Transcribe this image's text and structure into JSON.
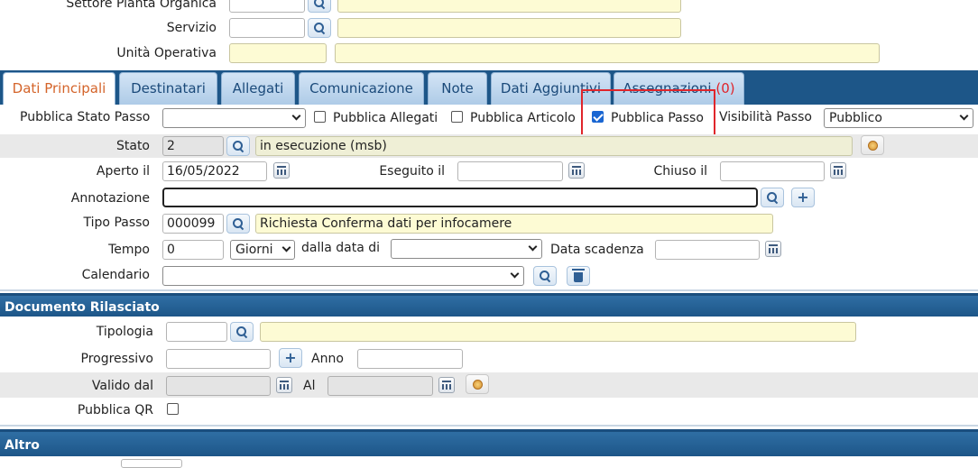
{
  "top_fields": {
    "settore_label": "Settore Pianta Organica",
    "servizio_label": "Servizio",
    "unita_label": "Unità Operativa"
  },
  "tabs": [
    {
      "label": "Dati Principali",
      "active": true
    },
    {
      "label": "Destinatari"
    },
    {
      "label": "Allegati"
    },
    {
      "label": "Comunicazione"
    },
    {
      "label": "Note"
    },
    {
      "label": "Dati Aggiuntivi"
    },
    {
      "label": "Assegnazioni",
      "count": "(0)"
    }
  ],
  "publish_row": {
    "stato_passo_label": "Pubblica Stato Passo",
    "stato_passo_value": "",
    "allegati_label": "Pubblica Allegati",
    "allegati_checked": false,
    "articolo_label": "Pubblica Articolo",
    "articolo_checked": false,
    "passo_label": "Pubblica Passo",
    "passo_checked": true,
    "visibilita_label": "Visibilità Passo",
    "visibilita_value": "Pubblico"
  },
  "stato": {
    "label": "Stato",
    "code": "2",
    "description": "in esecuzione (msb)"
  },
  "dates": {
    "aperto_label": "Aperto il",
    "aperto_value": "16/05/2022",
    "eseguito_label": "Eseguito il",
    "eseguito_value": "",
    "chiuso_label": "Chiuso il",
    "chiuso_value": ""
  },
  "annotazione": {
    "label": "Annotazione",
    "value": ""
  },
  "tipo_passo": {
    "label": "Tipo Passo",
    "code": "000099",
    "description": "Richiesta Conferma dati per infocamere"
  },
  "tempo": {
    "label": "Tempo",
    "value": "0",
    "unit": "Giorni",
    "dalla_label": "dalla data di",
    "dalla_value": "",
    "scadenza_label": "Data scadenza",
    "scadenza_value": ""
  },
  "calendario": {
    "label": "Calendario",
    "value": ""
  },
  "documento": {
    "header": "Documento Rilasciato",
    "tipologia_label": "Tipologia",
    "progressivo_label": "Progressivo",
    "anno_label": "Anno",
    "valido_label": "Valido dal",
    "al_label": "Al",
    "qr_label": "Pubblica QR",
    "qr_checked": false
  },
  "altro": {
    "header": "Altro"
  },
  "colors": {
    "tab_active_text": "#d4642a",
    "tab_text": "#1b4a7a",
    "section_header": "#1d5688",
    "highlight_box": "#e0252b",
    "assegnazioni_count": "#e0252b"
  }
}
